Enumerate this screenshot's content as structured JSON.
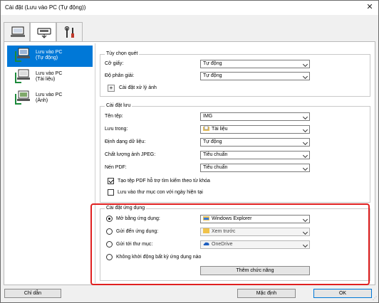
{
  "window": {
    "title": "Cài đặt (Lưu vào PC (Tự động))",
    "close": "✕"
  },
  "tabs": [
    {
      "name": "scan-from-operation-panel",
      "icon": "computer-scan-icon"
    },
    {
      "name": "scan-to-pc",
      "icon": "scanner-icon"
    },
    {
      "name": "general-settings",
      "icon": "tools-icon"
    }
  ],
  "nav": {
    "items": [
      {
        "label": "Lưu vào PC\n(Tự động)",
        "selected": true
      },
      {
        "label": "Lưu vào PC\n(Tài liệu)",
        "selected": false
      },
      {
        "label": "Lưu vào PC\n(Ảnh)",
        "selected": false
      }
    ]
  },
  "scan_options": {
    "title": "Tùy chọn quét",
    "paper_size": {
      "label": "Cỡ giấy:",
      "value": "Tự động"
    },
    "resolution": {
      "label": "Độ phân giải:",
      "value": "Tự động"
    },
    "image_processing": {
      "plus": "+",
      "label": "Cài đặt xử lý ảnh"
    }
  },
  "save_settings": {
    "title": "Cài đặt lưu",
    "file_name": {
      "label": "Tên tệp:",
      "value": "IMG"
    },
    "save_in": {
      "label": "Lưu trong:",
      "value": "Tài liệu"
    },
    "data_format": {
      "label": "Định dạng dữ liệu:",
      "value": "Tự động"
    },
    "jpeg_quality": {
      "label": "Chất lượng ảnh JPEG:",
      "value": "Tiêu chuẩn"
    },
    "pdf_compression": {
      "label": "Nén PDF:",
      "value": "Tiêu chuẩn"
    },
    "searchable_pdf": {
      "label": "Tạo tệp PDF hỗ trợ tìm kiếm theo từ khóa",
      "checked": true
    },
    "subfolder": {
      "label": "Lưu vào thư mục con với ngày hiện tại",
      "checked": false
    }
  },
  "app_settings": {
    "title": "Cài đặt ứng dụng",
    "open_with": {
      "label": "Mở bằng ứng dụng:",
      "value": "Windows Explorer",
      "checked": true
    },
    "send_to_app": {
      "label": "Gửi đến ứng dụng:",
      "value": "Xem trước",
      "checked": false
    },
    "send_to_folder": {
      "label": "Gửi tới thư mục:",
      "value": "OneDrive",
      "checked": false
    },
    "no_app": {
      "label": "Không khởi động bất kỳ ứng dụng nào",
      "checked": false
    },
    "more_functions": "Thêm chức năng"
  },
  "footer": {
    "instructions": "Chỉ dẫn",
    "defaults": "Mặc định",
    "ok": "OK"
  },
  "colors": {
    "selection": "#0078d7",
    "highlight": "#e02020"
  }
}
